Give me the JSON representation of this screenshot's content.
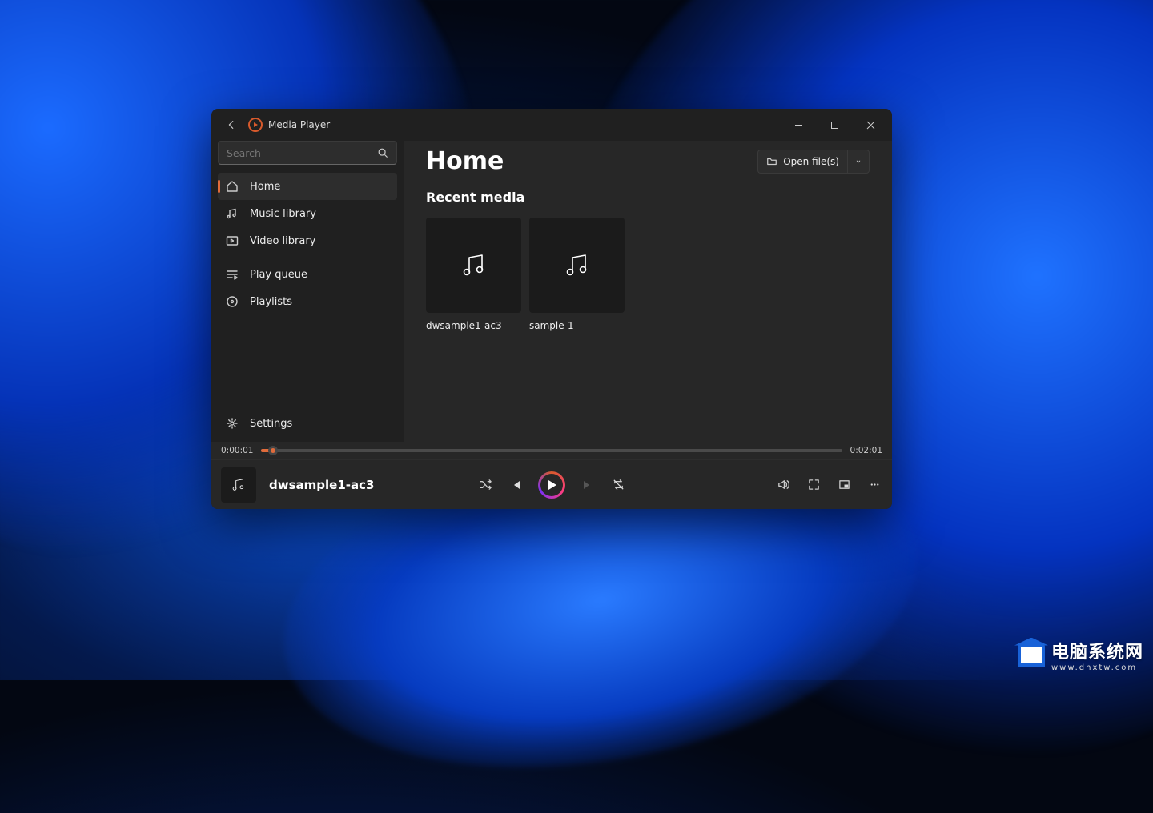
{
  "app": {
    "title": "Media Player"
  },
  "search": {
    "placeholder": "Search"
  },
  "sidebar": {
    "items": [
      {
        "label": "Home",
        "icon": "home-icon",
        "active": true
      },
      {
        "label": "Music library",
        "icon": "music-library-icon"
      },
      {
        "label": "Video library",
        "icon": "video-library-icon"
      },
      {
        "label": "Play queue",
        "icon": "queue-icon"
      },
      {
        "label": "Playlists",
        "icon": "playlists-icon"
      }
    ],
    "settings_label": "Settings"
  },
  "header": {
    "title": "Home",
    "open_files_label": "Open file(s)"
  },
  "recent": {
    "title": "Recent media",
    "items": [
      {
        "name": "dwsample1-ac3"
      },
      {
        "name": "sample-1"
      }
    ]
  },
  "player": {
    "elapsed": "0:00:01",
    "duration": "0:02:01",
    "now_playing_title": "dwsample1-ac3"
  },
  "watermark": {
    "main": "电脑系统网",
    "sub": "www.dnxtw.com"
  }
}
